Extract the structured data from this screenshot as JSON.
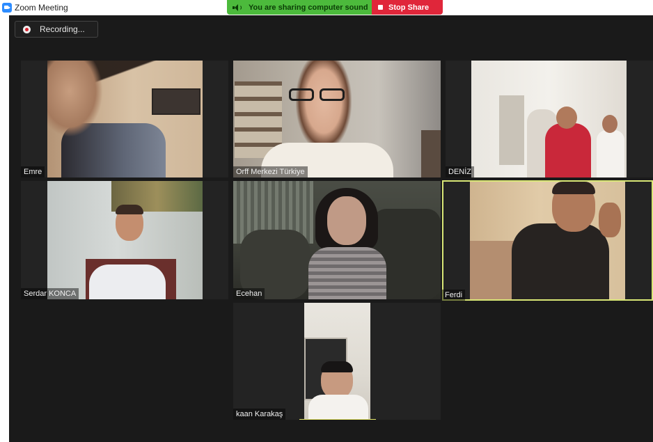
{
  "window": {
    "title": "Zoom Meeting",
    "app_icon": "zoom-logo-icon"
  },
  "share_bar": {
    "sharing_text": "You are sharing computer sound",
    "sharing_icon": "speaker-icon",
    "stop_label": "Stop Share",
    "stop_icon": "stop-icon",
    "colors": {
      "sharing_bg": "#4cba3c",
      "stop_bg": "#e0263a"
    }
  },
  "recording": {
    "label": "Recording...",
    "icon": "record-icon"
  },
  "participants": [
    {
      "name": "Emre"
    },
    {
      "name": "Orff Merkezi Türkiye"
    },
    {
      "name": "DENİZ"
    },
    {
      "name": "Serdar KONCA"
    },
    {
      "name": "Ecehan"
    },
    {
      "name": "Ferdi",
      "active_speaker": true
    },
    {
      "name": "kaan Karakaş"
    }
  ],
  "colors": {
    "meeting_bg": "#1a1a1a",
    "tile_bg": "#232323",
    "active_speaker_border": "#d9e776"
  }
}
